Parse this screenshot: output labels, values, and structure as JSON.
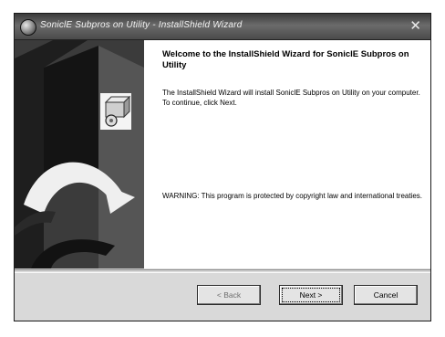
{
  "window": {
    "title": "SoniclE Subpros on Utility - InstallShield Wizard",
    "close_glyph": "✕"
  },
  "content": {
    "heading": "Welcome to the InstallShield Wizard for SoniclE Subpros on Utility",
    "intro": "The InstallShield Wizard will install SoniclE Subpros on Utility on your computer. To continue, click Next.",
    "warning": "WARNING: This program is protected by copyright law and international treaties."
  },
  "buttons": {
    "back": "< Back",
    "next": "Next >",
    "cancel": "Cancel"
  },
  "icons": {
    "window": "installer-disc-icon",
    "product": "package-box-icon"
  },
  "colors": {
    "titlebar": "#4a4a4a",
    "side_art": "#3d3d3d",
    "panel": "#d9d9d9"
  }
}
